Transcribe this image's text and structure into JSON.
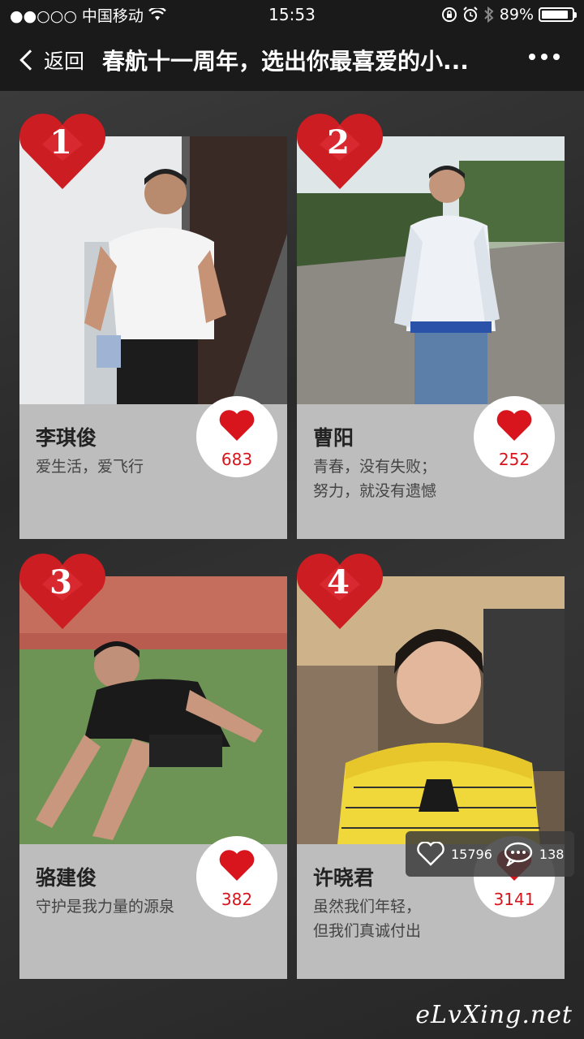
{
  "status_bar": {
    "carrier": "●●○○○ 中国移动",
    "time": "15:53",
    "battery": "89%",
    "battery_level": 0.89
  },
  "nav": {
    "back_label": "返回",
    "title": "春航十一周年，选出你最喜爱的小..."
  },
  "cards": [
    {
      "rank": "1",
      "name": "李琪俊",
      "desc1": "爱生活，爱飞行",
      "desc2": "",
      "votes": "683"
    },
    {
      "rank": "2",
      "name": "曹阳",
      "desc1": "青春，没有失败；",
      "desc2": "努力，就没有遗憾",
      "votes": "252"
    },
    {
      "rank": "3",
      "name": "骆建俊",
      "desc1": "守护是我力量的源泉",
      "desc2": "",
      "votes": "382"
    },
    {
      "rank": "4",
      "name": "许晓君",
      "desc1": "虽然我们年轻，",
      "desc2": "但我们真诚付出",
      "votes": "3141"
    }
  ],
  "float_bar": {
    "likes": "15796",
    "comments": "138"
  },
  "watermark": "eLvXing.net",
  "colors": {
    "heart": "#d8141c",
    "accent_heart_badge": "#cc1d22"
  },
  "icons": [
    "wifi-icon",
    "lock-rotation-icon",
    "alarm-icon",
    "bluetooth-icon",
    "battery-icon",
    "back-chevron-icon",
    "more-icon",
    "heart-icon",
    "comment-icon"
  ]
}
